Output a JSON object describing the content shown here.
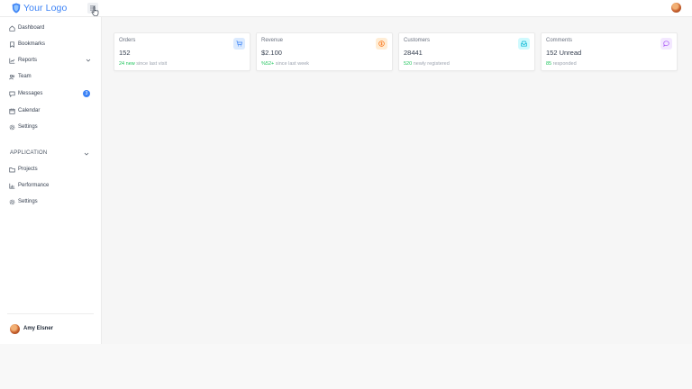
{
  "header": {
    "logo_text": "Your Logo",
    "logo_icon": "shield-logo-icon",
    "menu_icon": "menu-icon",
    "avatar": "user-avatar"
  },
  "sidebar": {
    "items": [
      {
        "label": "Dashboard",
        "icon": "home-icon"
      },
      {
        "label": "Bookmarks",
        "icon": "bookmark-icon"
      },
      {
        "label": "Reports",
        "icon": "chart-icon",
        "chevron": "chevron-down-icon"
      },
      {
        "label": "Team",
        "icon": "team-icon"
      },
      {
        "label": "Messages",
        "icon": "message-icon",
        "badge": "3"
      },
      {
        "label": "Calendar",
        "icon": "calendar-icon"
      },
      {
        "label": "Settings",
        "icon": "gear-icon"
      }
    ],
    "section_title": "APPLICATION",
    "application_items": [
      {
        "label": "Projects",
        "icon": "folder-icon"
      },
      {
        "label": "Performance",
        "icon": "chart-icon"
      },
      {
        "label": "Settings",
        "icon": "gear-icon"
      }
    ],
    "user_name": "Amy Elsner"
  },
  "cards": [
    {
      "title": "Orders",
      "value": "152",
      "accent_text": "24 new",
      "rest_text": " since last visit",
      "icon": "cart-icon",
      "icon_color": "#3b82f6",
      "icon_bg": "#dbeafe"
    },
    {
      "title": "Revenue",
      "value": "$2.100",
      "accent_text": "%52+",
      "rest_text": " since last week",
      "icon": "dollar-icon",
      "icon_color": "#f97316",
      "icon_bg": "#ffedd5"
    },
    {
      "title": "Customers",
      "value": "28441",
      "accent_text": "520",
      "rest_text": "  newly registered",
      "icon": "inbox-icon",
      "icon_color": "#06b6d4",
      "icon_bg": "#cffafe"
    },
    {
      "title": "Comments",
      "value": "152 Unread",
      "accent_text": "85",
      "rest_text": " responded",
      "icon": "comment-icon",
      "icon_color": "#a855f7",
      "icon_bg": "#f3e8ff"
    }
  ],
  "colors": {
    "brand": "#3b82f6",
    "accent_positive": "#22c55e",
    "badge": "#3b82f6"
  }
}
